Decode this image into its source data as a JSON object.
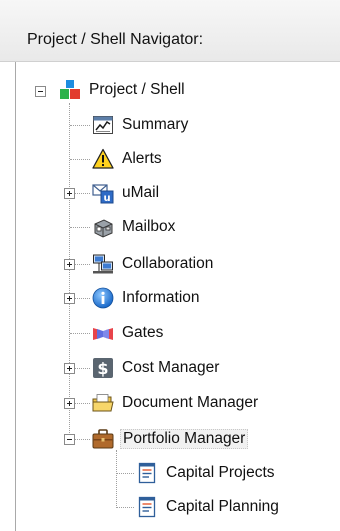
{
  "panel": {
    "title": "Project / Shell Navigator:"
  },
  "tree": {
    "root": {
      "label": "Project / Shell",
      "icon": "project-shell-icon",
      "expanded": true
    },
    "items": [
      {
        "label": "Summary",
        "icon": "summary-icon",
        "expandable": false
      },
      {
        "label": "Alerts",
        "icon": "alert-icon",
        "expandable": false
      },
      {
        "label": "uMail",
        "icon": "umail-icon",
        "expandable": true,
        "expanded": false
      },
      {
        "label": "Mailbox",
        "icon": "mailbox-icon",
        "expandable": false
      },
      {
        "label": "Collaboration",
        "icon": "collaboration-icon",
        "expandable": true,
        "expanded": false
      },
      {
        "label": "Information",
        "icon": "information-icon",
        "expandable": true,
        "expanded": false
      },
      {
        "label": "Gates",
        "icon": "gates-icon",
        "expandable": false
      },
      {
        "label": "Cost Manager",
        "icon": "cost-manager-icon",
        "expandable": true,
        "expanded": false
      },
      {
        "label": "Document Manager",
        "icon": "document-manager-icon",
        "expandable": true,
        "expanded": false
      },
      {
        "label": "Portfolio Manager",
        "icon": "portfolio-manager-icon",
        "expandable": true,
        "expanded": true,
        "selected": true
      }
    ],
    "portfolio_children": [
      {
        "label": "Capital Projects",
        "icon": "capital-projects-icon"
      },
      {
        "label": "Capital Planning",
        "icon": "capital-planning-icon"
      }
    ]
  }
}
